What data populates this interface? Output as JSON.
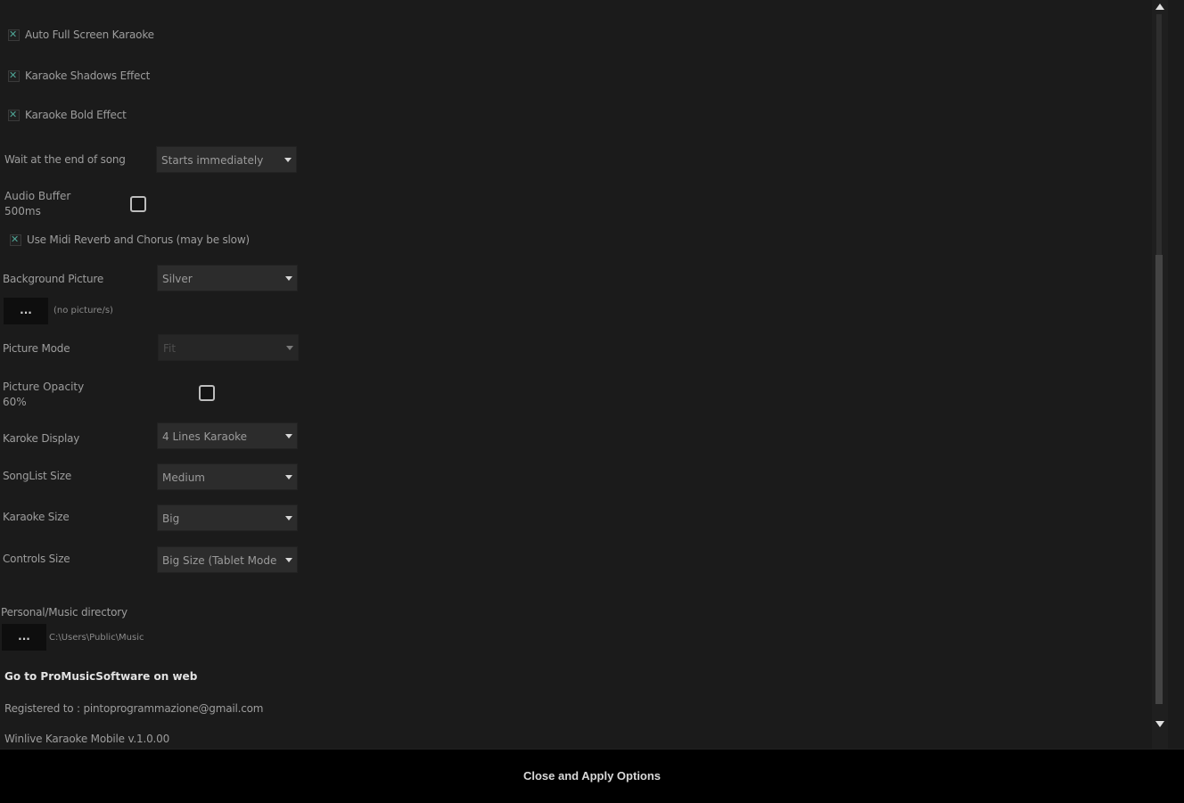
{
  "options": {
    "auto_full_screen": {
      "label": "Auto Full Screen Karaoke",
      "checked": true
    },
    "shadows_effect": {
      "label": "Karaoke Shadows Effect",
      "checked": true
    },
    "bold_effect": {
      "label": "Karaoke Bold Effect",
      "checked": true
    },
    "wait_end_song": {
      "label": "Wait at the end of song",
      "value": "Starts immediately"
    },
    "audio_buffer": {
      "label_line1": "Audio Buffer",
      "label_line2": "500ms"
    },
    "midi_reverb": {
      "label": "Use Midi Reverb and Chorus (may be slow)",
      "checked": true
    },
    "background_picture": {
      "label": "Background Picture",
      "value": "Silver"
    },
    "picture_browse": {
      "button": "...",
      "path": "(no picture/s)"
    },
    "picture_mode": {
      "label": "Picture Mode",
      "value": "Fit"
    },
    "picture_opacity": {
      "label_line1": "Picture Opacity",
      "label_line2": "60%"
    },
    "karoke_display": {
      "label": "Karoke Display",
      "value": "4 Lines Karaoke"
    },
    "songlist_size": {
      "label": "SongList Size",
      "value": "Medium"
    },
    "karaoke_size": {
      "label": "Karaoke Size",
      "value": "Big"
    },
    "controls_size": {
      "label": "Controls Size",
      "value": "Big Size (Tablet Mode"
    },
    "music_dir": {
      "label": "Personal/Music directory",
      "button": "...",
      "path": "C:\\Users\\Public\\Music"
    }
  },
  "links": {
    "website": "Go to ProMusicSoftware on web"
  },
  "info": {
    "registered": "Registered to : pintoprogrammazione@gmail.com",
    "version": "Winlive Karaoke Mobile v.1.0.00"
  },
  "footer": {
    "apply_button": "Close and Apply Options"
  },
  "colors": {
    "background": "#1b1b1b",
    "check_accent": "#4fa596",
    "footer": "#000000"
  }
}
